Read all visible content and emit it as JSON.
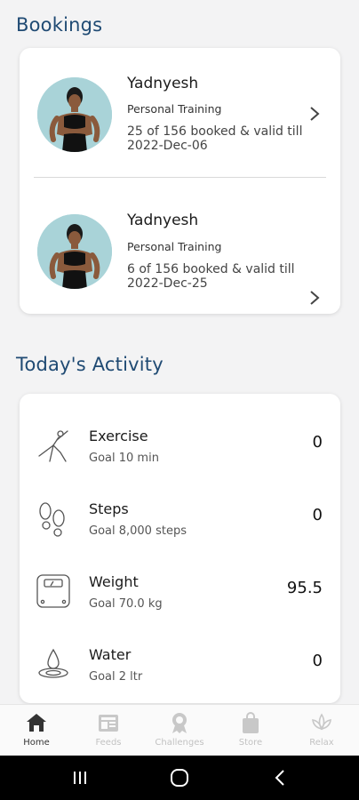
{
  "sections": {
    "bookings_title": "Bookings",
    "activity_title": "Today's Activity"
  },
  "bookings": [
    {
      "trainer": "Yadnyesh",
      "type": "Personal Training",
      "detail": "25 of 156 booked & valid till 2022-Dec-06",
      "avatar_icon": "trainer-avatar"
    },
    {
      "trainer": "Yadnyesh",
      "type": "Personal Training",
      "detail": "6 of 156 booked & valid till 2022-Dec-25",
      "avatar_icon": "trainer-avatar"
    }
  ],
  "activity": [
    {
      "name": "Exercise",
      "goal": "Goal 10 min",
      "value": "0",
      "icon": "exercise-icon"
    },
    {
      "name": "Steps",
      "goal": "Goal 8,000 steps",
      "value": "0",
      "icon": "steps-icon"
    },
    {
      "name": "Weight",
      "goal": "Goal 70.0 kg",
      "value": "95.5",
      "icon": "weight-scale-icon"
    },
    {
      "name": "Water",
      "goal": "Goal 2 ltr",
      "value": "0",
      "icon": "water-drop-icon"
    }
  ],
  "bottom_nav": [
    {
      "label": "Home",
      "icon": "home-icon",
      "active": true
    },
    {
      "label": "Feeds",
      "icon": "feeds-icon",
      "active": false
    },
    {
      "label": "Challenges",
      "icon": "challenges-icon",
      "active": false
    },
    {
      "label": "Store",
      "icon": "store-bag-icon",
      "active": false
    },
    {
      "label": "Relax",
      "icon": "lotus-icon",
      "active": false
    }
  ],
  "colors": {
    "title": "#1f4a73",
    "avatar_bg": "#a9d3d8",
    "nav_active": "#333333",
    "nav_inactive": "#c2c2c2"
  }
}
